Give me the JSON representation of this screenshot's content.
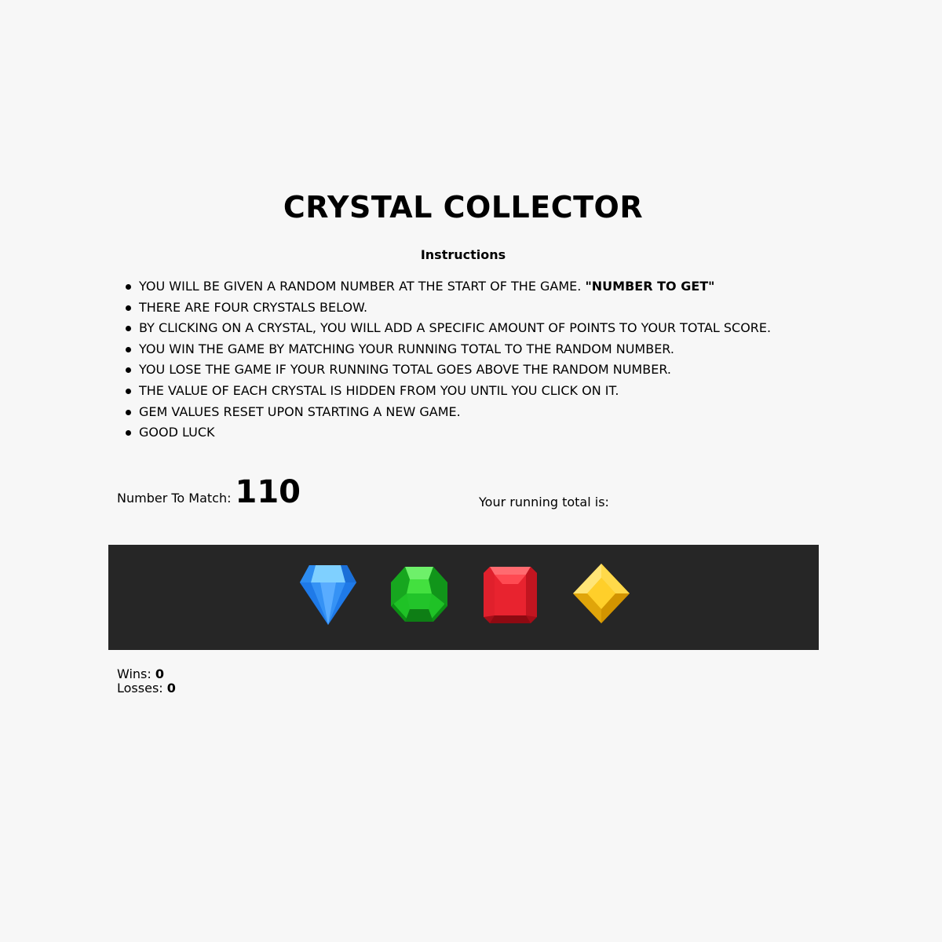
{
  "title": "CRYSTAL COLLECTOR",
  "instructions": {
    "heading": "Instructions",
    "rules": [
      {
        "text": "YOU WILL BE GIVEN A RANDOM NUMBER AT THE START OF THE GAME. ",
        "bold": "\"NUMBER TO GET\""
      },
      {
        "text": "THERE ARE FOUR CRYSTALS BELOW.",
        "bold": ""
      },
      {
        "text": "BY CLICKING ON A CRYSTAL, YOU WILL ADD A SPECIFIC AMOUNT OF POINTS TO YOUR TOTAL SCORE.",
        "bold": ""
      },
      {
        "text": "YOU WIN THE GAME BY MATCHING YOUR RUNNING TOTAL TO THE RANDOM NUMBER.",
        "bold": ""
      },
      {
        "text": "YOU LOSE THE GAME IF YOUR RUNNING TOTAL GOES ABOVE THE RANDOM NUMBER.",
        "bold": ""
      },
      {
        "text": "THE VALUE OF EACH CRYSTAL IS HIDDEN FROM YOU UNTIL YOU CLICK ON IT.",
        "bold": ""
      },
      {
        "text": "GEM VALUES RESET UPON STARTING A NEW GAME.",
        "bold": ""
      },
      {
        "text": "GOOD LUCK",
        "bold": ""
      }
    ]
  },
  "target": {
    "label": "Number To Match:",
    "value": "110"
  },
  "running_total": {
    "label": "Your running total is:",
    "value": ""
  },
  "gems": [
    {
      "name": "blue-crystal",
      "icon": "blue-diamond-gem-icon",
      "color": "#1a7ff0"
    },
    {
      "name": "green-crystal",
      "icon": "green-octagon-gem-icon",
      "color": "#19c21f"
    },
    {
      "name": "red-crystal",
      "icon": "red-square-gem-icon",
      "color": "#e01a2b"
    },
    {
      "name": "yellow-crystal",
      "icon": "yellow-rhombus-gem-icon",
      "color": "#f5c211"
    }
  ],
  "score": {
    "wins_label": "Wins:",
    "wins": "0",
    "losses_label": "Losses:",
    "losses": "0"
  },
  "colors": {
    "background": "#f7f7f7",
    "gem_bar": "#262626"
  }
}
